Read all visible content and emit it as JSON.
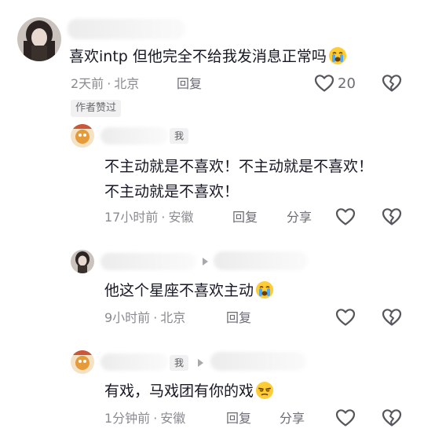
{
  "comments": [
    {
      "text": "喜欢intp 但他完全不给我发消息正常吗",
      "time": "2天前",
      "location": "北京",
      "reply_label": "回复",
      "like_count": "20",
      "author_liked_badge": "作者赞过"
    },
    {
      "me_badge": "我",
      "text_line1": "不主动就是不喜欢！不主动就是不喜欢！",
      "text_line2": "不主动就是不喜欢！",
      "time": "17小时前",
      "location": "安徽",
      "reply_label": "回复",
      "share_label": "分享"
    },
    {
      "text": "他这个星座不喜欢主动",
      "time": "9小时前",
      "location": "北京",
      "reply_label": "回复"
    },
    {
      "me_badge": "我",
      "text": "有戏，马戏团有你的戏",
      "time": "1分钟前",
      "location": "安徽",
      "reply_label": "回复",
      "share_label": "分享"
    }
  ],
  "separator_dot": "·",
  "icons": {
    "like": "heart-outline-icon",
    "dislike": "broken-heart-icon",
    "emoji_cry": "loudly-crying-face-emoji",
    "emoji_smirk": "unamused-face-emoji"
  },
  "colors": {
    "text": "#161823",
    "meta": "#8a8b91",
    "action": "#6b6c72",
    "badge_bg": "#f1f1f2"
  }
}
